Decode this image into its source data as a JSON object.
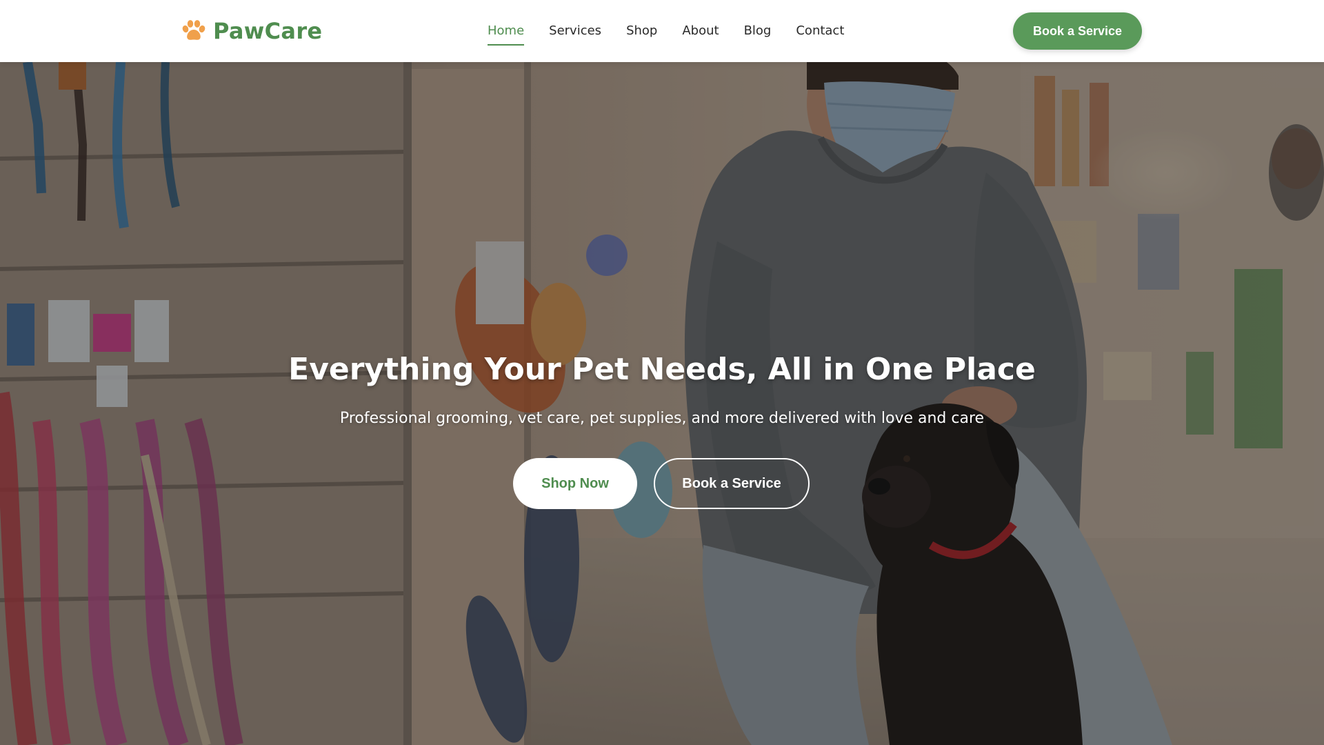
{
  "brand": {
    "name": "PawCare",
    "logo_icon": "paw-icon",
    "accent_color": "#4f8d4f"
  },
  "nav": {
    "items": [
      {
        "label": "Home",
        "active": true
      },
      {
        "label": "Services",
        "active": false
      },
      {
        "label": "Shop",
        "active": false
      },
      {
        "label": "About",
        "active": false
      },
      {
        "label": "Blog",
        "active": false
      },
      {
        "label": "Contact",
        "active": false
      }
    ]
  },
  "header": {
    "cta_label": "Book a Service",
    "cta_color": "#5a9a5a"
  },
  "hero": {
    "title": "Everything Your Pet Needs, All in One Place",
    "subtitle": "Professional grooming, vet care, pet supplies, and more delivered with love and care",
    "primary_button": "Shop Now",
    "secondary_button": "Book a Service",
    "background_image": "pet-store-man-with-dog-photo"
  }
}
